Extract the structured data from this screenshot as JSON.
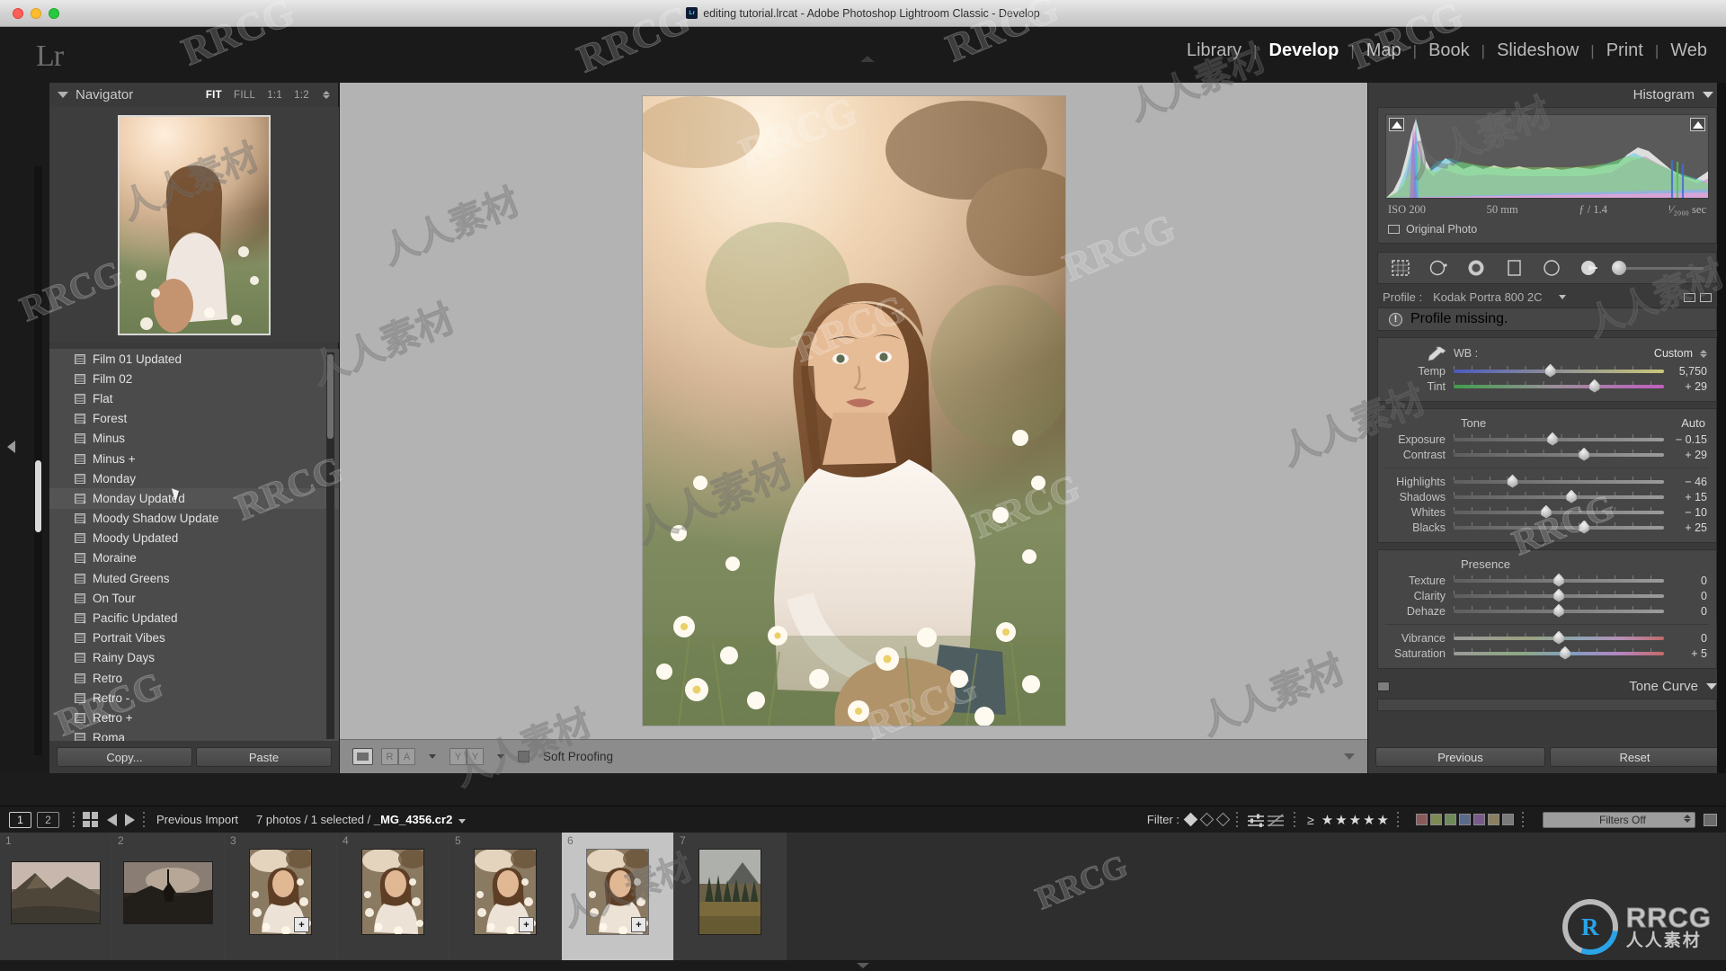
{
  "window": {
    "title": "editing tutorial.lrcat - Adobe Photoshop Lightroom Classic - Develop",
    "app_badge": "Lr"
  },
  "identity": {
    "logo": "Lr"
  },
  "modules": [
    {
      "label": "Library",
      "active": false
    },
    {
      "label": "Develop",
      "active": true
    },
    {
      "label": "Map",
      "active": false
    },
    {
      "label": "Book",
      "active": false
    },
    {
      "label": "Slideshow",
      "active": false
    },
    {
      "label": "Print",
      "active": false
    },
    {
      "label": "Web",
      "active": false
    }
  ],
  "navigator": {
    "title": "Navigator",
    "zoom_levels": [
      "FIT",
      "FILL",
      "1:1",
      "1:2"
    ],
    "active_zoom": "FIT"
  },
  "presets": {
    "items": [
      {
        "name": "Film 01 Updated",
        "modified": false
      },
      {
        "name": "Film 02",
        "modified": false
      },
      {
        "name": "Flat",
        "modified": false
      },
      {
        "name": "Forest",
        "modified": true
      },
      {
        "name": "Minus",
        "modified": true
      },
      {
        "name": "Minus +",
        "modified": false
      },
      {
        "name": "Monday",
        "modified": false
      },
      {
        "name": "Monday Updated",
        "modified": true,
        "hovered": true
      },
      {
        "name": "Moody Shadow Update",
        "modified": true
      },
      {
        "name": "Moody Updated",
        "modified": false
      },
      {
        "name": "Moraine",
        "modified": true
      },
      {
        "name": "Muted Greens",
        "modified": false
      },
      {
        "name": "On Tour",
        "modified": false
      },
      {
        "name": "Pacific Updated",
        "modified": true
      },
      {
        "name": "Portrait Vibes",
        "modified": false
      },
      {
        "name": "Rainy Days",
        "modified": false
      },
      {
        "name": "Retro",
        "modified": false
      },
      {
        "name": "Retro -",
        "modified": false
      },
      {
        "name": "Retro +",
        "modified": false
      },
      {
        "name": "Roma",
        "modified": false
      }
    ]
  },
  "left_toolbar": {
    "copy_label": "Copy...",
    "paste_label": "Paste"
  },
  "center_toolbar": {
    "loupe_view": "loupe-view",
    "before_after_ra": "RA",
    "before_after_yy": "YY",
    "soft_proofing_label": "Soft Proofing",
    "soft_proofing_checked": false
  },
  "histogram": {
    "title": "Histogram",
    "iso": "ISO 200",
    "focal_length": "50 mm",
    "aperture": "ƒ / 1.4",
    "shutter": "¹⁄₂₀₀₀ sec",
    "original_photo_label": "Original Photo"
  },
  "tools": [
    "crop-overlay-icon",
    "spot-removal-icon",
    "red-eye-icon",
    "graduated-filter-icon",
    "radial-filter-icon",
    "adjustment-brush-icon"
  ],
  "basic": {
    "profile_label": "Profile :",
    "profile_value": "Kodak Portra 800 2C",
    "profile_warning": "Profile missing.",
    "wb_label": "WB :",
    "wb_value": "Custom",
    "white_balance": [
      {
        "label": "Temp",
        "value": "5,750",
        "pos": 46,
        "track": "temp"
      },
      {
        "label": "Tint",
        "value": "+ 29",
        "pos": 67,
        "track": "tint"
      }
    ],
    "tone_title": "Tone",
    "auto_label": "Auto",
    "tone": [
      {
        "label": "Exposure",
        "value": "− 0.15",
        "pos": 47,
        "track": "grey"
      },
      {
        "label": "Contrast",
        "value": "+ 29",
        "pos": 62,
        "track": "grey"
      },
      {
        "label": "Highlights",
        "value": "− 46",
        "pos": 28,
        "track": "grey"
      },
      {
        "label": "Shadows",
        "value": "+ 15",
        "pos": 56,
        "track": "grey"
      },
      {
        "label": "Whites",
        "value": "− 10",
        "pos": 44,
        "track": "grey"
      },
      {
        "label": "Blacks",
        "value": "+ 25",
        "pos": 62,
        "track": "grey"
      }
    ],
    "presence_title": "Presence",
    "presence": [
      {
        "label": "Texture",
        "value": "0",
        "pos": 50,
        "track": "grey"
      },
      {
        "label": "Clarity",
        "value": "0",
        "pos": 50,
        "track": "grey"
      },
      {
        "label": "Dehaze",
        "value": "0",
        "pos": 50,
        "track": "grey"
      },
      {
        "label": "Vibrance",
        "value": "0",
        "pos": 50,
        "track": "vib"
      },
      {
        "label": "Saturation",
        "value": "+ 5",
        "pos": 53,
        "track": "sat"
      }
    ]
  },
  "tone_curve": {
    "title": "Tone Curve"
  },
  "right_toolbar": {
    "previous_label": "Previous",
    "reset_label": "Reset"
  },
  "filmstrip_bar": {
    "screen_1": "1",
    "screen_2": "2",
    "source_label": "Previous Import",
    "count_prefix": "7 photos / 1 selected / ",
    "filename": "_MG_4356.cr2",
    "filter_label": "Filter :",
    "filters_off": "Filters Off",
    "star_count": 5,
    "color_chips": [
      "#8a5a5a",
      "#7c8a55",
      "#6f8a5a",
      "#5a6a8a",
      "#7a5a8a",
      "#8a8060",
      "#7a7a7a"
    ]
  },
  "filmstrip": {
    "cells": [
      {
        "num": "1",
        "kind": "landscape-mountain",
        "selected": false,
        "badge": ""
      },
      {
        "num": "2",
        "kind": "landscape-tower",
        "selected": false,
        "badge": ""
      },
      {
        "num": "3",
        "kind": "portrait-girl",
        "selected": false,
        "badge": "+"
      },
      {
        "num": "4",
        "kind": "portrait-girl",
        "selected": false,
        "badge": ""
      },
      {
        "num": "5",
        "kind": "portrait-girl",
        "selected": false,
        "badge": "+"
      },
      {
        "num": "6",
        "kind": "portrait-girl",
        "selected": true,
        "badge": "+"
      },
      {
        "num": "7",
        "kind": "landscape-forest",
        "selected": false,
        "badge": ""
      }
    ]
  },
  "watermark": {
    "brand": "RRCG",
    "brand_cn": "人人素材"
  },
  "colors": {
    "panel_bg": "#3a3a3a",
    "panel_inner": "#464646",
    "canvas_bg": "#b3b3b3",
    "accent_blue": "#2aa3e8",
    "text_primary": "#e2e2e2",
    "text_muted": "#b0b0b0"
  }
}
